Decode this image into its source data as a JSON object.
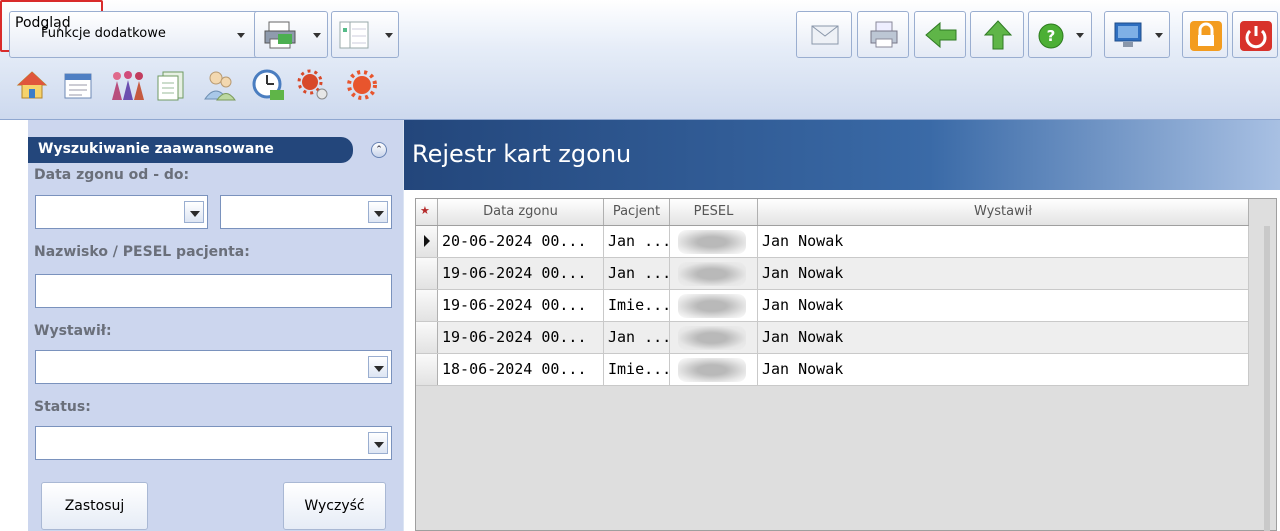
{
  "toolbar": {
    "funkcje_label": "Funkcje dodatkowe",
    "podglad_label": "Podgląd",
    "icons_left": [
      "home-icon",
      "calendar-list-icon",
      "patients-icon",
      "documents-icon",
      "users-icon",
      "clock-icon",
      "virus-icon",
      "virus-gear-icon"
    ],
    "icons_right": [
      "mail-icon",
      "printer-small-icon",
      "back-arrow-icon",
      "up-arrow-icon",
      "help-icon",
      "monitor-icon",
      "lock-icon",
      "power-icon"
    ],
    "colors": {
      "accent_red": "#d92b2b",
      "header_blue": "#23467b"
    }
  },
  "filters": {
    "title": "Wyszukiwanie zaawansowane",
    "date_label": "Data zgonu od - do:",
    "name_label": "Nazwisko / PESEL pacjenta:",
    "issuer_label": "Wystawił:",
    "status_label": "Status:",
    "apply_label": "Zastosuj",
    "clear_label": "Wyczyść"
  },
  "main": {
    "title": "Rejestr kart zgonu",
    "columns": [
      "Data zgonu",
      "Pacjent",
      "PESEL",
      "Wystawił"
    ],
    "rows": [
      {
        "date": "20-06-2024 00...",
        "patient": "Jan ...",
        "issuer": "Jan Nowak"
      },
      {
        "date": "19-06-2024 00...",
        "patient": "Jan ...",
        "issuer": "Jan Nowak"
      },
      {
        "date": "19-06-2024 00...",
        "patient": "Imie...",
        "issuer": "Jan Nowak"
      },
      {
        "date": "19-06-2024 00...",
        "patient": "Jan ...",
        "issuer": "Jan Nowak"
      },
      {
        "date": "18-06-2024 00...",
        "patient": "Imie...",
        "issuer": "Jan Nowak"
      }
    ]
  }
}
